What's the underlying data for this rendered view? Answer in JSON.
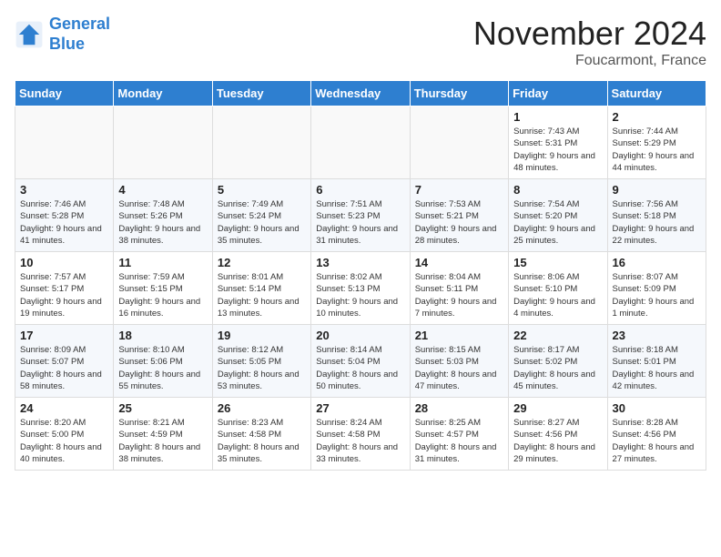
{
  "logo": {
    "line1": "General",
    "line2": "Blue"
  },
  "title": "November 2024",
  "location": "Foucarmont, France",
  "days_of_week": [
    "Sunday",
    "Monday",
    "Tuesday",
    "Wednesday",
    "Thursday",
    "Friday",
    "Saturday"
  ],
  "weeks": [
    [
      {
        "day": "",
        "info": ""
      },
      {
        "day": "",
        "info": ""
      },
      {
        "day": "",
        "info": ""
      },
      {
        "day": "",
        "info": ""
      },
      {
        "day": "",
        "info": ""
      },
      {
        "day": "1",
        "info": "Sunrise: 7:43 AM\nSunset: 5:31 PM\nDaylight: 9 hours and 48 minutes."
      },
      {
        "day": "2",
        "info": "Sunrise: 7:44 AM\nSunset: 5:29 PM\nDaylight: 9 hours and 44 minutes."
      }
    ],
    [
      {
        "day": "3",
        "info": "Sunrise: 7:46 AM\nSunset: 5:28 PM\nDaylight: 9 hours and 41 minutes."
      },
      {
        "day": "4",
        "info": "Sunrise: 7:48 AM\nSunset: 5:26 PM\nDaylight: 9 hours and 38 minutes."
      },
      {
        "day": "5",
        "info": "Sunrise: 7:49 AM\nSunset: 5:24 PM\nDaylight: 9 hours and 35 minutes."
      },
      {
        "day": "6",
        "info": "Sunrise: 7:51 AM\nSunset: 5:23 PM\nDaylight: 9 hours and 31 minutes."
      },
      {
        "day": "7",
        "info": "Sunrise: 7:53 AM\nSunset: 5:21 PM\nDaylight: 9 hours and 28 minutes."
      },
      {
        "day": "8",
        "info": "Sunrise: 7:54 AM\nSunset: 5:20 PM\nDaylight: 9 hours and 25 minutes."
      },
      {
        "day": "9",
        "info": "Sunrise: 7:56 AM\nSunset: 5:18 PM\nDaylight: 9 hours and 22 minutes."
      }
    ],
    [
      {
        "day": "10",
        "info": "Sunrise: 7:57 AM\nSunset: 5:17 PM\nDaylight: 9 hours and 19 minutes."
      },
      {
        "day": "11",
        "info": "Sunrise: 7:59 AM\nSunset: 5:15 PM\nDaylight: 9 hours and 16 minutes."
      },
      {
        "day": "12",
        "info": "Sunrise: 8:01 AM\nSunset: 5:14 PM\nDaylight: 9 hours and 13 minutes."
      },
      {
        "day": "13",
        "info": "Sunrise: 8:02 AM\nSunset: 5:13 PM\nDaylight: 9 hours and 10 minutes."
      },
      {
        "day": "14",
        "info": "Sunrise: 8:04 AM\nSunset: 5:11 PM\nDaylight: 9 hours and 7 minutes."
      },
      {
        "day": "15",
        "info": "Sunrise: 8:06 AM\nSunset: 5:10 PM\nDaylight: 9 hours and 4 minutes."
      },
      {
        "day": "16",
        "info": "Sunrise: 8:07 AM\nSunset: 5:09 PM\nDaylight: 9 hours and 1 minute."
      }
    ],
    [
      {
        "day": "17",
        "info": "Sunrise: 8:09 AM\nSunset: 5:07 PM\nDaylight: 8 hours and 58 minutes."
      },
      {
        "day": "18",
        "info": "Sunrise: 8:10 AM\nSunset: 5:06 PM\nDaylight: 8 hours and 55 minutes."
      },
      {
        "day": "19",
        "info": "Sunrise: 8:12 AM\nSunset: 5:05 PM\nDaylight: 8 hours and 53 minutes."
      },
      {
        "day": "20",
        "info": "Sunrise: 8:14 AM\nSunset: 5:04 PM\nDaylight: 8 hours and 50 minutes."
      },
      {
        "day": "21",
        "info": "Sunrise: 8:15 AM\nSunset: 5:03 PM\nDaylight: 8 hours and 47 minutes."
      },
      {
        "day": "22",
        "info": "Sunrise: 8:17 AM\nSunset: 5:02 PM\nDaylight: 8 hours and 45 minutes."
      },
      {
        "day": "23",
        "info": "Sunrise: 8:18 AM\nSunset: 5:01 PM\nDaylight: 8 hours and 42 minutes."
      }
    ],
    [
      {
        "day": "24",
        "info": "Sunrise: 8:20 AM\nSunset: 5:00 PM\nDaylight: 8 hours and 40 minutes."
      },
      {
        "day": "25",
        "info": "Sunrise: 8:21 AM\nSunset: 4:59 PM\nDaylight: 8 hours and 38 minutes."
      },
      {
        "day": "26",
        "info": "Sunrise: 8:23 AM\nSunset: 4:58 PM\nDaylight: 8 hours and 35 minutes."
      },
      {
        "day": "27",
        "info": "Sunrise: 8:24 AM\nSunset: 4:58 PM\nDaylight: 8 hours and 33 minutes."
      },
      {
        "day": "28",
        "info": "Sunrise: 8:25 AM\nSunset: 4:57 PM\nDaylight: 8 hours and 31 minutes."
      },
      {
        "day": "29",
        "info": "Sunrise: 8:27 AM\nSunset: 4:56 PM\nDaylight: 8 hours and 29 minutes."
      },
      {
        "day": "30",
        "info": "Sunrise: 8:28 AM\nSunset: 4:56 PM\nDaylight: 8 hours and 27 minutes."
      }
    ]
  ]
}
